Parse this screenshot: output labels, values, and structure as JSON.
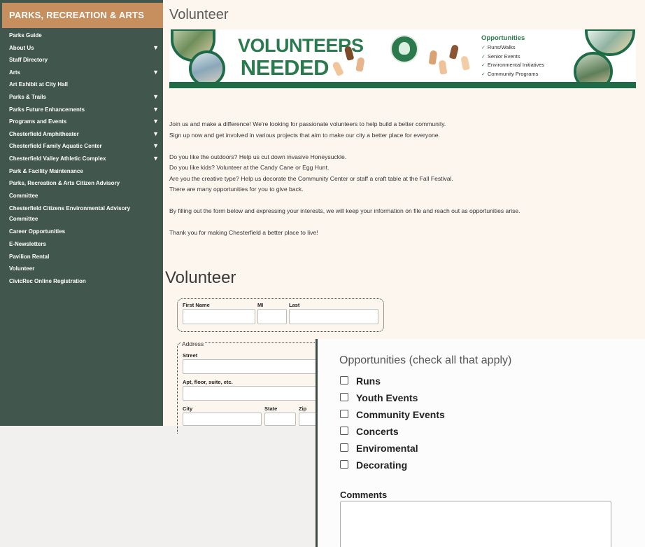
{
  "sidebar": {
    "header": "PARKS, RECREATION & ARTS",
    "items": [
      {
        "label": "Parks Guide",
        "caret": false
      },
      {
        "label": "About Us",
        "caret": true
      },
      {
        "label": "Staff Directory",
        "caret": false
      },
      {
        "label": "Arts",
        "caret": true
      },
      {
        "label": "Art Exhibit at City Hall",
        "caret": false
      },
      {
        "label": "Parks & Trails",
        "caret": true
      },
      {
        "label": "Parks Future Enhancements",
        "caret": true
      },
      {
        "label": "Programs and Events",
        "caret": true
      },
      {
        "label": "Chesterfield Amphitheater",
        "caret": true
      },
      {
        "label": "Chesterfield Family Aquatic Center",
        "caret": true
      },
      {
        "label": "Chesterfield Valley Athletic Complex",
        "caret": true
      },
      {
        "label": "Park & Facility Maintenance",
        "caret": false
      },
      {
        "label": "Parks, Recreation & Arts Citizen Advisory Committee",
        "caret": false
      },
      {
        "label": "Chesterfield Citizens Environmental Advisory Committee",
        "caret": false
      },
      {
        "label": "Career Opportunities",
        "caret": false
      },
      {
        "label": "E-Newsletters",
        "caret": false
      },
      {
        "label": "Pavilion Rental",
        "caret": false
      },
      {
        "label": "Volunteer",
        "caret": false
      },
      {
        "label": "CivicRec Online Registration",
        "caret": false
      }
    ],
    "caret_glyph": "▼"
  },
  "page": {
    "title": "Volunteer",
    "form_title": "Volunteer"
  },
  "banner": {
    "title_line1": "VOLUNTEERS",
    "title_line2": "NEEDED",
    "opportunities_title": "Opportunities",
    "opportunities": [
      "Runs/Walks",
      "Senior Events",
      "Environmental Initiatives",
      "Community Programs"
    ],
    "check_glyph": "✓",
    "colors": {
      "green": "#2b7a4e",
      "dark_green": "#1f6b48"
    }
  },
  "intro": {
    "p1_l1": "Join us and make a difference!  We're looking for passionate volunteers to help build a better community.",
    "p1_l2": "Sign up now and get involved in various projects that aim to make our city a better place for everyone.",
    "p2_l1": "Do you like the outdoors?  Help us cut down invasive Honeysuckle.",
    "p2_l2": "Do you like kids? Volunteer at the Candy Cane or Egg Hunt.",
    "p2_l3": "Are you the creative type? Help us decorate the Community Center or staff a craft table at the Fall Festival.",
    "p2_l4": "There are many opportunities for you to give back.",
    "p3": "By filling out the form below and expressing your interests, we will keep your information on file and reach out as opportunities arise.",
    "p4": "Thank you for making Chesterfield a better place to live!"
  },
  "form": {
    "first_name_label": "First Name",
    "mi_label": "MI",
    "last_label": "Last",
    "address_legend": "Address",
    "street_label": "Street",
    "apt_label": "Apt, floor, suite, etc.",
    "city_label": "City",
    "state_label": "State",
    "zip_label": "Zip"
  },
  "opportunities_form": {
    "heading": "Opportunities (check all that apply)",
    "options": [
      "Runs",
      "Youth Events",
      "Community Events",
      "Concerts",
      "Enviromental",
      "Decorating"
    ],
    "comments_label": "Comments"
  }
}
